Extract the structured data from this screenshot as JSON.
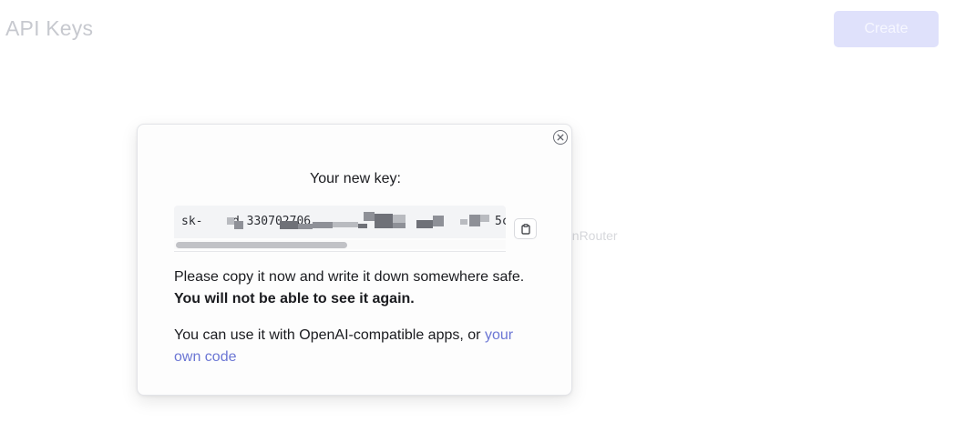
{
  "page": {
    "title": "API Keys",
    "create_label": "Create",
    "hint_fragment": "enRouter"
  },
  "modal": {
    "title": "Your new key:",
    "key_prefix": "sk-",
    "key_visible_fragment": "d 330702706",
    "key_suffix_fragment": "5c",
    "scroll_position_fraction": 0.5,
    "paragraph1_text": "Please copy it now and write it down somewhere safe.",
    "paragraph1_bold": "You will not be able to see it again.",
    "paragraph2_text": "You can use it with OpenAI-compatible apps, or",
    "paragraph2_link": "your own code"
  },
  "icons": {
    "close": "close-circle-icon",
    "copy": "clipboard-icon"
  },
  "colors": {
    "accent": "#6b76d4",
    "create_button_bg": "#dfe1fb",
    "text": "#1a1b1f"
  }
}
